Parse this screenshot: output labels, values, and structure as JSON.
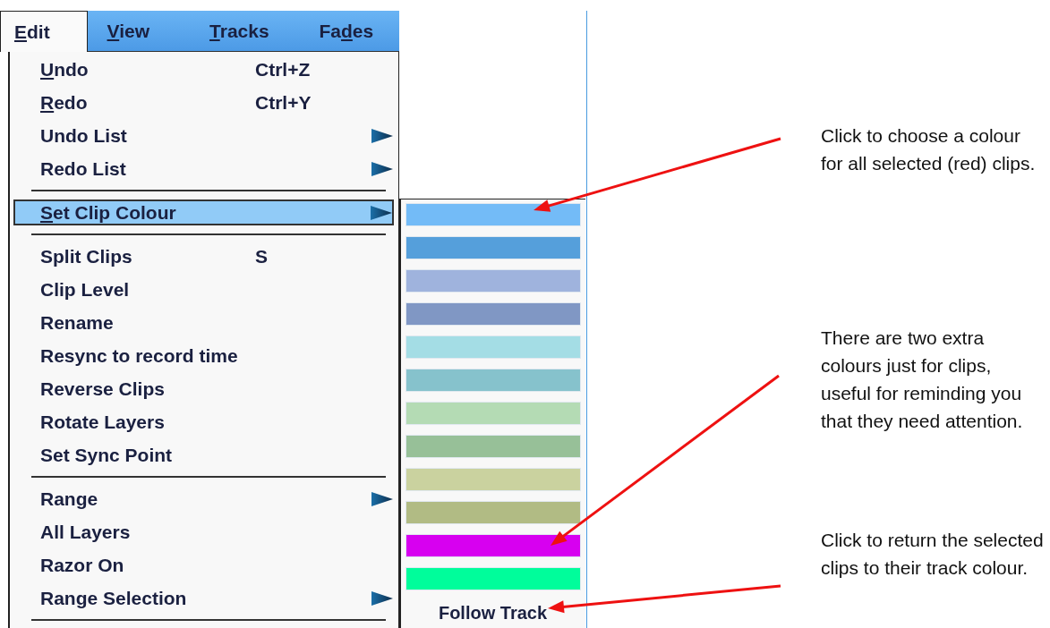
{
  "menu_bar": [
    {
      "selected": true,
      "label": [
        {
          "text": "E",
          "underlined": true
        },
        {
          "text": "dit",
          "underlined": false
        }
      ]
    },
    {
      "selected": false,
      "label": [
        {
          "text": "V",
          "underlined": true
        },
        {
          "text": "iew",
          "underlined": false
        }
      ]
    },
    {
      "selected": false,
      "label": [
        {
          "text": "T",
          "underlined": true
        },
        {
          "text": "racks",
          "underlined": false
        }
      ]
    },
    {
      "selected": false,
      "label": [
        {
          "text": "Fa",
          "underlined": false
        },
        {
          "text": "d",
          "underlined": true
        },
        {
          "text": "es",
          "underlined": false
        }
      ]
    }
  ],
  "edit_menu": [
    {
      "kind": "item",
      "selected": false,
      "submenu": false,
      "label": [
        {
          "text": "U",
          "underlined": true
        },
        {
          "text": "ndo",
          "underlined": false
        }
      ],
      "shortcut": "Ctrl+Z"
    },
    {
      "kind": "item",
      "selected": false,
      "submenu": false,
      "label": [
        {
          "text": "R",
          "underlined": true
        },
        {
          "text": "edo",
          "underlined": false
        }
      ],
      "shortcut": "Ctrl+Y"
    },
    {
      "kind": "item",
      "selected": false,
      "submenu": true,
      "label": [
        {
          "text": "Undo List",
          "underlined": false
        }
      ]
    },
    {
      "kind": "item",
      "selected": false,
      "submenu": true,
      "label": [
        {
          "text": "Redo List",
          "underlined": false
        }
      ]
    },
    {
      "kind": "separator"
    },
    {
      "kind": "item",
      "selected": true,
      "submenu": true,
      "label": [
        {
          "text": "S",
          "underlined": true
        },
        {
          "text": "et Clip Colour",
          "underlined": false
        }
      ]
    },
    {
      "kind": "separator"
    },
    {
      "kind": "item",
      "selected": false,
      "submenu": false,
      "label": [
        {
          "text": "Split Clips",
          "underlined": false
        }
      ],
      "shortcut": "S"
    },
    {
      "kind": "item",
      "selected": false,
      "submenu": false,
      "label": [
        {
          "text": "Clip Level",
          "underlined": false
        }
      ]
    },
    {
      "kind": "item",
      "selected": false,
      "submenu": false,
      "label": [
        {
          "text": "Rename",
          "underlined": false
        }
      ]
    },
    {
      "kind": "item",
      "selected": false,
      "submenu": false,
      "label": [
        {
          "text": "Resync to record time",
          "underlined": false
        }
      ]
    },
    {
      "kind": "item",
      "selected": false,
      "submenu": false,
      "label": [
        {
          "text": "Reverse Clips",
          "underlined": false
        }
      ]
    },
    {
      "kind": "item",
      "selected": false,
      "submenu": false,
      "label": [
        {
          "text": "Rotate Layers",
          "underlined": false
        }
      ]
    },
    {
      "kind": "item",
      "selected": false,
      "submenu": false,
      "label": [
        {
          "text": "Set Sync Point",
          "underlined": false
        }
      ]
    },
    {
      "kind": "separator"
    },
    {
      "kind": "item",
      "selected": false,
      "submenu": true,
      "label": [
        {
          "text": "Range",
          "underlined": false
        }
      ]
    },
    {
      "kind": "item",
      "selected": false,
      "submenu": false,
      "label": [
        {
          "text": "All Layers",
          "underlined": false
        }
      ]
    },
    {
      "kind": "item",
      "selected": false,
      "submenu": false,
      "label": [
        {
          "text": "Razor On",
          "underlined": false
        }
      ]
    },
    {
      "kind": "item",
      "selected": false,
      "submenu": true,
      "label": [
        {
          "text": "Range Selection",
          "underlined": false
        }
      ]
    },
    {
      "kind": "separator"
    }
  ],
  "colour_submenu": {
    "swatches": [
      {
        "color": "#73bbf7"
      },
      {
        "color": "#559fdb"
      },
      {
        "color": "#9fb3dd"
      },
      {
        "color": "#8097c4"
      },
      {
        "color": "#a4dde5"
      },
      {
        "color": "#86c2cc"
      },
      {
        "color": "#b4dbb4"
      },
      {
        "color": "#97c098"
      },
      {
        "color": "#cad29f"
      },
      {
        "color": "#b1bb84"
      },
      {
        "color": "#d700f0"
      },
      {
        "color": "#00fd9b"
      }
    ],
    "follow_track": "Follow Track"
  },
  "annotations": [
    {
      "text": "Click to choose a colour for all selected (red) clips."
    },
    {
      "text": "There are two extra colours just for clips, useful for reminding you that they need attention."
    },
    {
      "text": "Click to return the selected clips to their track colour."
    }
  ]
}
